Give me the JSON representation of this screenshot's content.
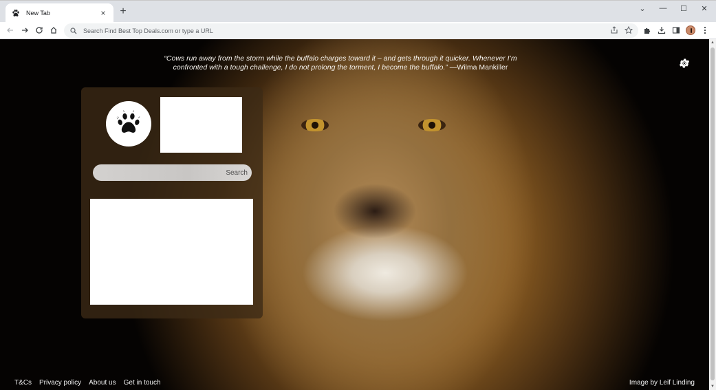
{
  "browser": {
    "tab": {
      "title": "New Tab",
      "close_icon": "×"
    },
    "new_tab_label": "+",
    "window_controls": {
      "chevron": "⌄",
      "minimize": "—",
      "maximize": "☐",
      "close": "✕"
    },
    "omnibox": {
      "placeholder": "Search Find Best Top Deals.com or type a URL"
    }
  },
  "page": {
    "quote": {
      "text": "“Cows run away from the storm while the buffalo charges toward it – and gets through it quicker. Whenever I’m confronted with a tough challenge, I do not prolong the torment, I become the buffalo.”",
      "author": " —Wilma Mankiller"
    },
    "search": {
      "button_label": "Search",
      "placeholder": ""
    },
    "footer_links": [
      "T&Cs",
      "Privacy policy",
      "About us",
      "Get in touch"
    ],
    "image_credit": "Image by Leif Linding"
  },
  "colors": {
    "panel": "#3c2a16",
    "tabbar": "#dee1e6",
    "omnibox": "#f1f3f4"
  }
}
